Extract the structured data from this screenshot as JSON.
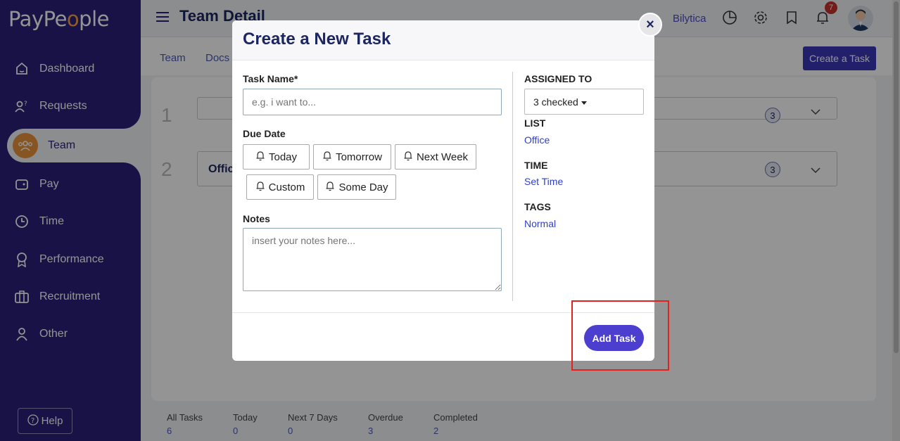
{
  "app": {
    "logo_text_a": "PayPe",
    "logo_text_o": "o",
    "logo_text_b": "ple"
  },
  "sidebar": {
    "items": [
      {
        "label": "Dashboard",
        "icon": "home-icon"
      },
      {
        "label": "Requests",
        "icon": "request-icon"
      },
      {
        "label": "Team",
        "icon": "team-icon"
      },
      {
        "label": "Pay",
        "icon": "wallet-icon"
      },
      {
        "label": "Time",
        "icon": "clock-icon"
      },
      {
        "label": "Performance",
        "icon": "award-icon"
      },
      {
        "label": "Recruitment",
        "icon": "briefcase-icon"
      },
      {
        "label": "Other",
        "icon": "user-icon"
      }
    ],
    "help_label": "Help"
  },
  "header": {
    "title": "Team Detail",
    "company": "Bilytica",
    "notifications_count": "7"
  },
  "subnav": {
    "tabs": [
      "Team",
      "Docs"
    ],
    "create_task_label": "Create a Task"
  },
  "content": {
    "rows": [
      {
        "num": "1",
        "label": "",
        "count": "3"
      },
      {
        "num": "2",
        "label": "Offic",
        "count": "3"
      }
    ]
  },
  "stats": [
    {
      "label": "All Tasks",
      "value": "6"
    },
    {
      "label": "Today",
      "value": "0"
    },
    {
      "label": "Next 7 Days",
      "value": "0"
    },
    {
      "label": "Overdue",
      "value": "3"
    },
    {
      "label": "Completed",
      "value": "2"
    }
  ],
  "modal": {
    "title": "Create a New Task",
    "close_symbol": "×",
    "task_name_label": "Task Name*",
    "task_name_placeholder": "e.g. i want to...",
    "due_date_label": "Due Date",
    "due_options": [
      "Today",
      "Tomorrow",
      "Next Week",
      "Custom",
      "Some Day"
    ],
    "notes_label": "Notes",
    "notes_placeholder": "insert your notes here...",
    "assigned_to_label": "ASSIGNED TO",
    "assigned_value": "3 checked",
    "list_label": "LIST",
    "list_value": "Office",
    "time_label": "TIME",
    "time_value": "Set Time",
    "tags_label": "TAGS",
    "tags_value": "Normal",
    "add_task_label": "Add Task"
  },
  "colors": {
    "sidebar_bg": "#2a1f7a",
    "accent": "#4c3fd0",
    "link": "#2f3fc8",
    "highlight": "#e3211f"
  }
}
